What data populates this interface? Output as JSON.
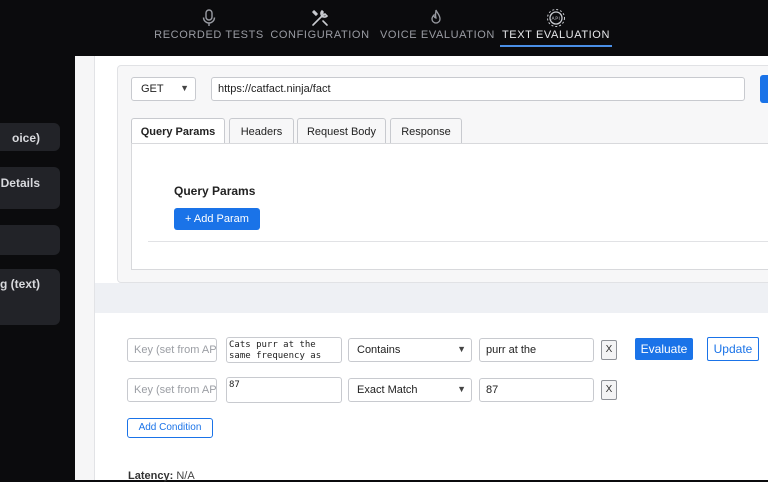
{
  "nav": {
    "tabs": [
      {
        "label": "RECORDED TESTS",
        "icon": "microphone-icon"
      },
      {
        "label": "CONFIGURATION",
        "icon": "tools-icon"
      },
      {
        "label": "VOICE EVALUATION",
        "icon": "flame-icon"
      },
      {
        "label": "TEXT EVALUATION",
        "icon": "api-gear-icon",
        "active": true
      }
    ]
  },
  "sidebar": {
    "items": [
      {
        "label": "oice)"
      },
      {
        "label": "Details"
      },
      {
        "label": ""
      },
      {
        "label": "ing (text)"
      }
    ]
  },
  "request": {
    "method": "GET",
    "url": "https://catfact.ninja/fact",
    "tabs": [
      "Query Params",
      "Headers",
      "Request Body",
      "Response"
    ],
    "active_tab": "Query Params",
    "query_params_title": "Query Params",
    "add_param_label": "+ Add Param"
  },
  "conditions": {
    "rows": [
      {
        "key_placeholder": "Key (set from API",
        "expected_text": "Cats purr at the same frequency as",
        "operator": "Contains",
        "value": "purr at the",
        "remove_label": "X"
      },
      {
        "key_placeholder": "Key (set from API",
        "expected_text": "87",
        "operator": "Exact Match",
        "value": "87",
        "remove_label": "X"
      }
    ],
    "evaluate_label": "Evaluate",
    "update_label": "Update",
    "add_condition_label": "Add Condition"
  },
  "latency": {
    "label": "Latency:",
    "value": "N/A"
  },
  "colors": {
    "accent": "#1a73e8",
    "nav_underline": "#4a8fe6",
    "background": "#0b0b0d"
  }
}
